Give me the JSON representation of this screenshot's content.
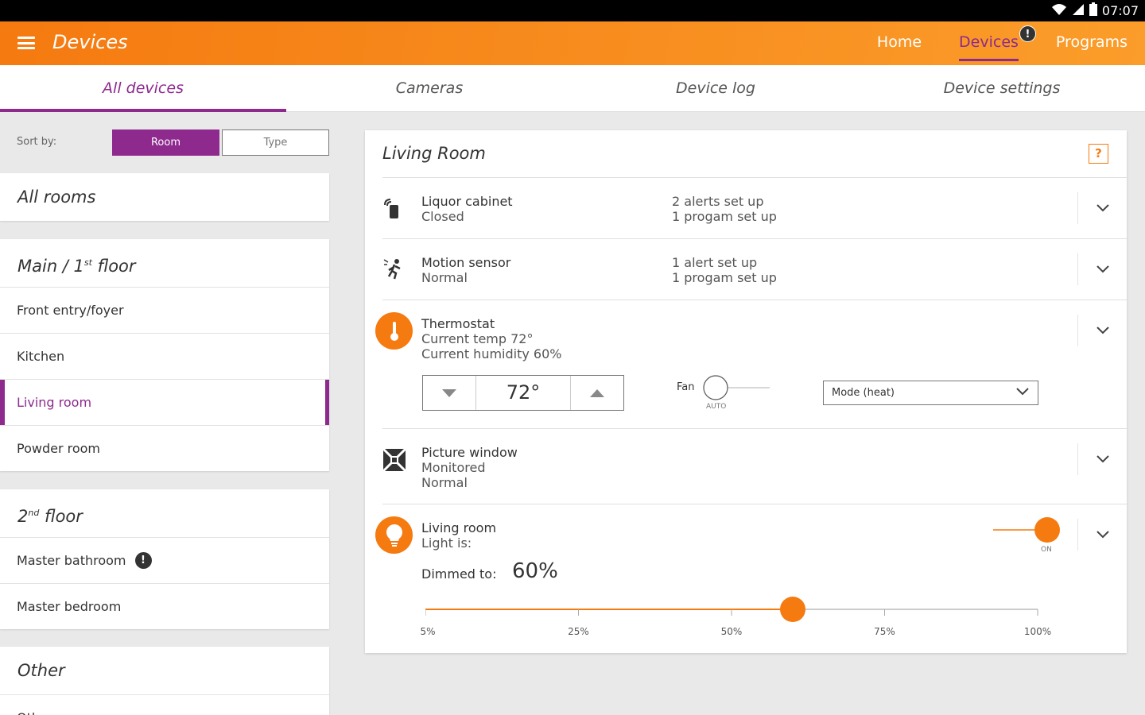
{
  "statusbar": {
    "time": "07:07"
  },
  "appbar": {
    "title": "Devices",
    "nav": [
      {
        "label": "Home"
      },
      {
        "label": "Devices",
        "badge": "!"
      },
      {
        "label": "Programs"
      }
    ]
  },
  "tabs": [
    "All devices",
    "Cameras",
    "Device log",
    "Device settings"
  ],
  "sidebar": {
    "sort_label": "Sort by:",
    "sort_options": [
      "Room",
      "Type"
    ],
    "all_rooms": "All rooms",
    "floor1": {
      "title_pre": "Main / 1",
      "title_sup": "st",
      "title_post": " floor",
      "rooms": [
        "Front entry/foyer",
        "Kitchen",
        "Living room",
        "Powder room"
      ]
    },
    "floor2": {
      "title_pre": "2",
      "title_sup": "nd",
      "title_post": " floor",
      "rooms": [
        "Master bathroom",
        "Master bedroom"
      ],
      "alert_badge": "!"
    },
    "other": {
      "title": "Other",
      "rooms": [
        "Oth"
      ]
    }
  },
  "panel": {
    "title": "Living Room",
    "help": "?",
    "devices": {
      "liquor": {
        "name": "Liquor cabinet",
        "status": "Closed",
        "info1": "2 alerts set up",
        "info2": "1 progam set up"
      },
      "motion": {
        "name": "Motion sensor",
        "status": "Normal",
        "info1": "1 alert set up",
        "info2": "1 progam set up"
      },
      "thermostat": {
        "name": "Thermostat",
        "temp": "Current temp 72°",
        "humidity": "Current humidity 60%",
        "setpoint": "72°",
        "fan_label": "Fan",
        "fan_state": "AUTO",
        "mode": "Mode (heat)"
      },
      "window": {
        "name": "Picture window",
        "status1": "Monitored",
        "status2": "Normal"
      },
      "light": {
        "name": "Living room",
        "status": "Light is:",
        "state": "ON",
        "dim_label": "Dimmed to:",
        "dim_value": "60%",
        "dim_fraction": 0.6,
        "ticks": [
          "5%",
          "25%",
          "50%",
          "75%",
          "100%"
        ]
      }
    }
  },
  "colors": {
    "accent": "#f57a10",
    "brand_purple": "#8e2a8e"
  }
}
